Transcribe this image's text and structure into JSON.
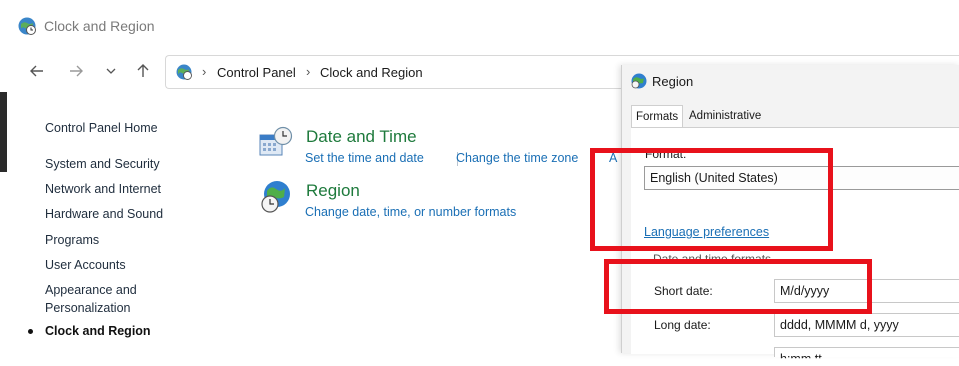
{
  "window": {
    "title": "Clock and Region"
  },
  "nav": {
    "back_icon": "arrow-left-icon",
    "forward_icon": "arrow-right-icon",
    "recent_icon": "chevron-down-icon",
    "up_icon": "arrow-up-icon",
    "breadcrumb": [
      "Control Panel",
      "Clock and Region"
    ]
  },
  "sidebar": {
    "items": [
      {
        "label": "Control Panel Home"
      },
      {
        "label": "System and Security"
      },
      {
        "label": "Network and Internet"
      },
      {
        "label": "Hardware and Sound"
      },
      {
        "label": "Programs"
      },
      {
        "label": "User Accounts"
      },
      {
        "label": "Appearance and"
      },
      {
        "label": "Personalization"
      },
      {
        "label": "Clock and Region"
      }
    ]
  },
  "categories": [
    {
      "title": "Date and Time",
      "icon": "calendar-clock-icon",
      "links": [
        "Set the time and date",
        "Change the time zone",
        "A"
      ]
    },
    {
      "title": "Region",
      "icon": "globe-clock-icon",
      "links": [
        "Change date, time, or number formats"
      ]
    }
  ],
  "dialog": {
    "title": "Region",
    "icon": "globe-icon",
    "tabs": [
      "Formats",
      "Administrative"
    ],
    "active_tab": "Formats",
    "format_label": "Format:",
    "format_value": "English (United States)",
    "language_link": "Language preferences",
    "group_title": "Date and time formats",
    "short_date_label": "Short date:",
    "short_date_value": "M/d/yyyy",
    "long_date_label": "Long date:",
    "long_date_value": "dddd, MMMM d, yyyy",
    "short_time_value": "h:mm tt"
  },
  "colors": {
    "annotation_red": "#e8111b",
    "link_blue": "#1a6fb5",
    "category_green": "#1e7a3c"
  }
}
